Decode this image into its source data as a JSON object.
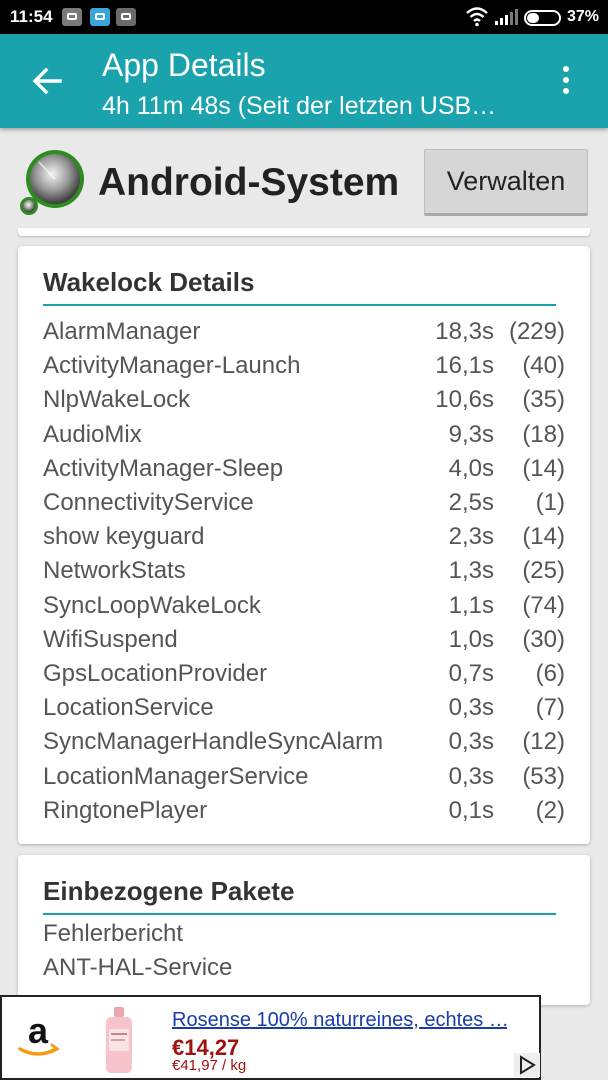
{
  "status_bar": {
    "time": "11:54",
    "battery_percent_label": "37%",
    "battery_level": 0.37,
    "icons": [
      "notification-icon",
      "app-notification-icon",
      "robot-notification-icon",
      "wifi-icon",
      "signal-icon",
      "battery-icon"
    ]
  },
  "toolbar": {
    "title": "App Details",
    "subtitle": "4h 11m 48s (Seit der letzten USB…",
    "back_icon": "back-arrow-icon",
    "more_icon": "more-vert-icon"
  },
  "app": {
    "name": "Android-System",
    "manage_label": "Verwalten"
  },
  "wakelocks": {
    "title": "Wakelock Details",
    "rows": [
      {
        "name": "AlarmManager",
        "time": "18,3s",
        "count": "(229)"
      },
      {
        "name": "ActivityManager-Launch",
        "time": "16,1s",
        "count": "(40)"
      },
      {
        "name": "NlpWakeLock",
        "time": "10,6s",
        "count": "(35)"
      },
      {
        "name": "AudioMix",
        "time": "9,3s",
        "count": "(18)"
      },
      {
        "name": "ActivityManager-Sleep",
        "time": "4,0s",
        "count": "(14)"
      },
      {
        "name": "ConnectivityService",
        "time": "2,5s",
        "count": "(1)"
      },
      {
        "name": "show keyguard",
        "time": "2,3s",
        "count": "(14)"
      },
      {
        "name": "NetworkStats",
        "time": "1,3s",
        "count": "(25)"
      },
      {
        "name": "SyncLoopWakeLock",
        "time": "1,1s",
        "count": "(74)"
      },
      {
        "name": "WifiSuspend",
        "time": "1,0s",
        "count": "(30)"
      },
      {
        "name": "GpsLocationProvider",
        "time": "0,7s",
        "count": "(6)"
      },
      {
        "name": "LocationService",
        "time": "0,3s",
        "count": "(7)"
      },
      {
        "name": "SyncManagerHandleSyncAlarm",
        "time": "0,3s",
        "count": "(12)"
      },
      {
        "name": "LocationManagerService",
        "time": "0,3s",
        "count": "(53)"
      },
      {
        "name": "RingtonePlayer",
        "time": "0,1s",
        "count": "(2)"
      }
    ]
  },
  "packages": {
    "title": "Einbezogene Pakete",
    "items": [
      "Fehlerbericht",
      "ANT-HAL-Service"
    ]
  },
  "ad": {
    "title": "Rosense 100% naturreines, echtes …",
    "price": "€14,27",
    "unit_price": "€41,97 / kg",
    "logo_icon": "amazon-logo-icon",
    "choices_icon": "ad-choices-icon"
  },
  "colors": {
    "accent": "#1aa3ad",
    "price": "#a01010",
    "link": "#1a3ca8"
  }
}
